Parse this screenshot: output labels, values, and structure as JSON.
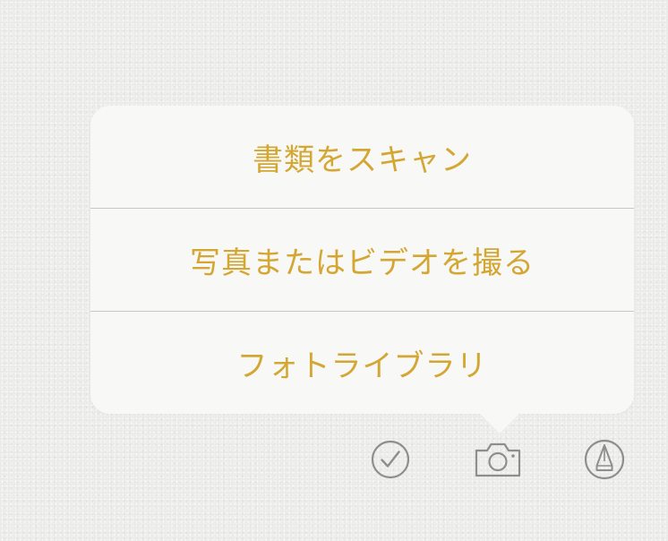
{
  "popover": {
    "items": [
      {
        "label": "書類をスキャン",
        "name": "scan-documents"
      },
      {
        "label": "写真またはビデオを撮る",
        "name": "take-photo-or-video"
      },
      {
        "label": "フォトライブラリ",
        "name": "photo-library"
      }
    ]
  },
  "toolbar": {
    "icons": [
      "checklist-icon",
      "camera-icon",
      "markup-pen-icon"
    ],
    "icon_color": "#8e8e8e"
  },
  "colors": {
    "accent": "#d4a632",
    "background": "#e9e9e7",
    "popover_bg": "#f8f8f7",
    "divider": "#c8c8c6"
  }
}
